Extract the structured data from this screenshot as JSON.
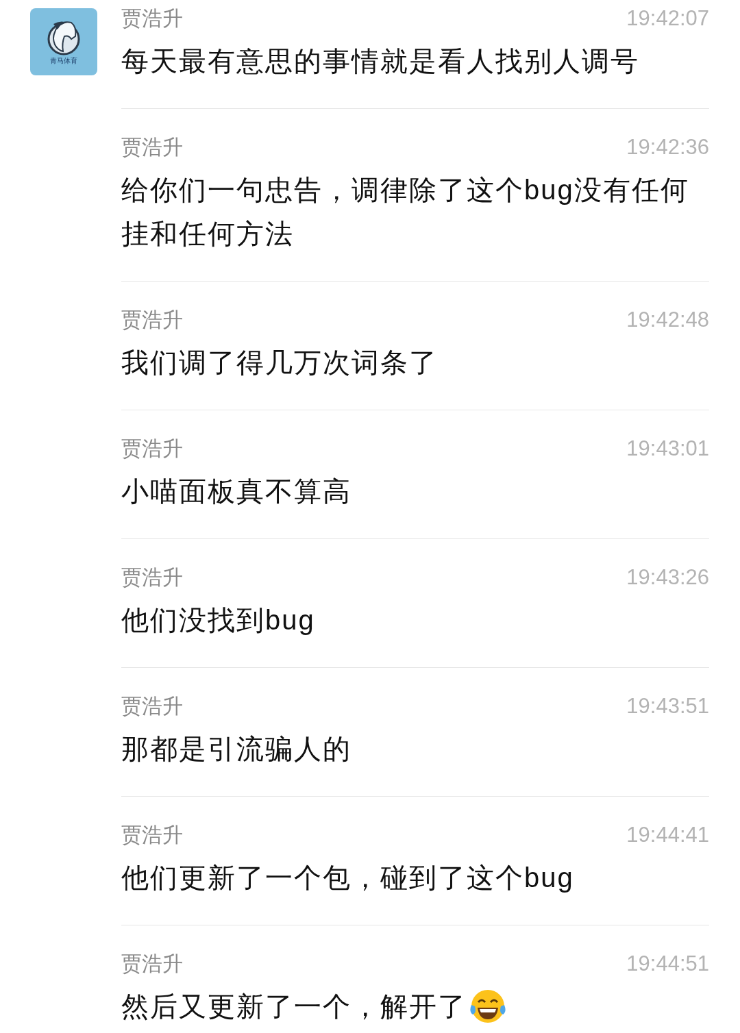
{
  "avatar": {
    "logo_text": "青马体育"
  },
  "messages": [
    {
      "sender": "贾浩升",
      "time": "19:42:07",
      "text": "每天最有意思的事情就是看人找别人调号"
    },
    {
      "sender": "贾浩升",
      "time": "19:42:36",
      "text": "给你们一句忠告，调律除了这个bug没有任何挂和任何方法"
    },
    {
      "sender": "贾浩升",
      "time": "19:42:48",
      "text": "我们调了得几万次词条了"
    },
    {
      "sender": "贾浩升",
      "time": "19:43:01",
      "text": "小喵面板真不算高"
    },
    {
      "sender": "贾浩升",
      "time": "19:43:26",
      "text": "他们没找到bug"
    },
    {
      "sender": "贾浩升",
      "time": "19:43:51",
      "text": "那都是引流骗人的"
    },
    {
      "sender": "贾浩升",
      "time": "19:44:41",
      "text": "他们更新了一个包，碰到了这个bug"
    },
    {
      "sender": "贾浩升",
      "time": "19:44:51",
      "text": "然后又更新了一个，解开了",
      "laughing_emoji": true
    }
  ]
}
